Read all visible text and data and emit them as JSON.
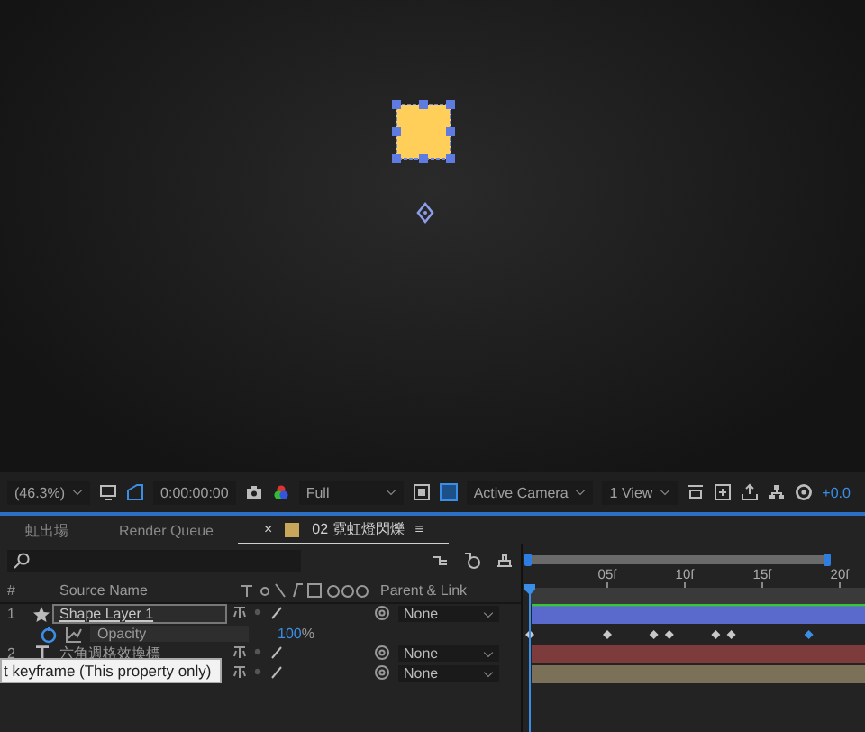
{
  "toolbar": {
    "zoom": "(46.3%)",
    "timecode": "0:00:00:00",
    "resolution": "Full",
    "camera": "Active Camera",
    "views": "1 View",
    "exposure": "+0.0"
  },
  "tabs": [
    {
      "label": "虹出場",
      "selected": false,
      "kind": "plain"
    },
    {
      "label": "Render Queue",
      "selected": false,
      "kind": "plain"
    },
    {
      "label": "02 霓虹燈閃爍",
      "selected": true,
      "kind": "comp",
      "close": "×",
      "menu": "≡"
    }
  ],
  "columns": {
    "number": "#",
    "source_name": "Source Name",
    "parent": "Parent & Link"
  },
  "ruler": [
    "05f",
    "10f",
    "15f",
    "20f"
  ],
  "layers": [
    {
      "number": "1",
      "kind": "shape",
      "name": "Shape Layer 1",
      "selected": true,
      "parent": "None",
      "color": "#5a69cc",
      "properties": [
        {
          "name": "Opacity",
          "value": "100",
          "unit": "%",
          "frames": [
            {
              "kind": "keyframe",
              "selected": false
            },
            {
              "kind": "empty"
            },
            {
              "kind": "empty"
            },
            {
              "kind": "empty"
            },
            {
              "kind": "empty"
            },
            {
              "kind": "keyframe",
              "selected": false
            },
            {
              "kind": "empty"
            },
            {
              "kind": "empty"
            },
            {
              "kind": "keyframe",
              "selected": false
            },
            {
              "kind": "keyframe",
              "selected": false
            },
            {
              "kind": "empty"
            },
            {
              "kind": "empty"
            },
            {
              "kind": "keyframe",
              "selected": false
            },
            {
              "kind": "keyframe",
              "selected": false
            },
            {
              "kind": "empty"
            },
            {
              "kind": "empty"
            },
            {
              "kind": "empty"
            },
            {
              "kind": "empty"
            },
            {
              "kind": "keyframe",
              "selected": true
            },
            {
              "kind": "empty"
            },
            {
              "kind": "empty"
            }
          ]
        }
      ]
    },
    {
      "number": "2",
      "kind": "text",
      "name": "六角週格效換標",
      "selected": false,
      "parent": "None",
      "color": "#7d3b3b"
    },
    {
      "parent": "None",
      "color": "#7b7058"
    }
  ],
  "tooltip": "t keyframe (This property only)"
}
